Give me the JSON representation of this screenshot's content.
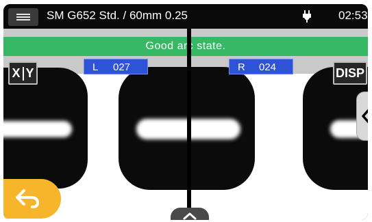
{
  "topbar": {
    "menu_icon": "hamburger-menu-icon",
    "title": "SM G652 Std. / 60mm 0.25",
    "power_icon": "plug-icon",
    "time": "02:53"
  },
  "status": {
    "message": "Good arc state.",
    "color": "#36b864"
  },
  "readouts": {
    "left_label": "L",
    "left_value": "027",
    "right_label": "R",
    "right_value": "024"
  },
  "buttons": {
    "xy_left": "X",
    "xy_right": "Y",
    "disp_label": "DISP",
    "back_icon": "undo-arrow-icon",
    "side_panel_icon": "chevron-left-icon",
    "bottom_panel_icon": "chevron-up-icon"
  },
  "colors": {
    "accent_back": "#f7b52b",
    "readout_bg": "#2e53d6"
  }
}
